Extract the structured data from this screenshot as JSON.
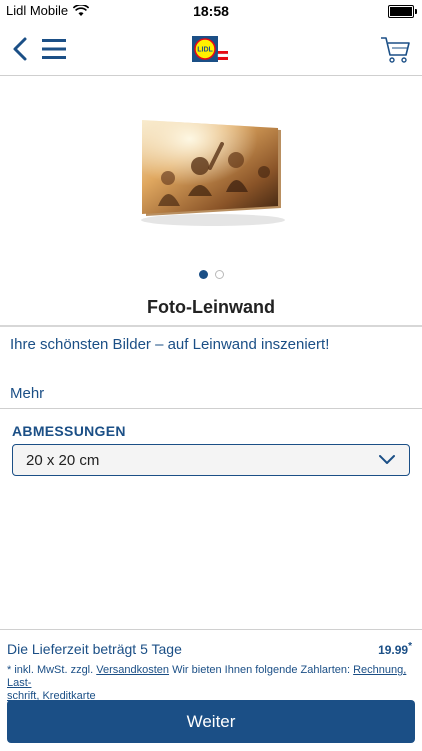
{
  "status_bar": {
    "carrier": "Lidl Mobile",
    "time": "18:58"
  },
  "header": {
    "logo_text": "LIDL",
    "back_icon": "chevron-left-icon",
    "menu_icon": "hamburger-icon",
    "cart_icon": "cart-icon"
  },
  "carousel": {
    "pages": 2,
    "active_page": 1
  },
  "product": {
    "title": "Foto-Leinwand",
    "tagline": "Ihre schönsten Bilder – auf Leinwand inszeniert!",
    "more_label": "Mehr"
  },
  "dimensions": {
    "label": "ABMESSUNGEN",
    "selected": "20 x 20 cm"
  },
  "footer": {
    "delivery": "Die Lieferzeit beträgt 5 Tage",
    "price": "19.99",
    "price_mark": "*",
    "legal_prefix": "* inkl. MwSt. zzgl.",
    "shipping_link": "Versandkosten",
    "legal_middle": "Wir bieten Ihnen folgende Zahlarten:",
    "payment_link_1": "Rechnung, Last-",
    "payment_link_2": "schrift, Kreditkarte",
    "button_label": "Weiter"
  },
  "colors": {
    "primary": "#1b4f86",
    "accent_yellow": "#fff000",
    "accent_red": "#e60a14",
    "divider": "#cfcfcf"
  }
}
